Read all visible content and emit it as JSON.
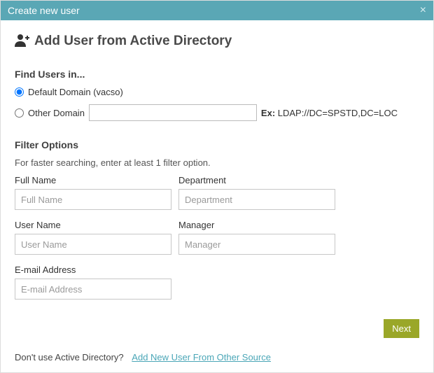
{
  "titlebar": {
    "title": "Create new user",
    "close_glyph": "×"
  },
  "header": {
    "title": "Add User from Active Directory"
  },
  "find_users": {
    "section_label": "Find Users in...",
    "default_domain": {
      "label": "Default Domain (vacso)",
      "checked": true
    },
    "other_domain": {
      "label": "Other Domain",
      "checked": false,
      "input_value": "",
      "hint_prefix": "Ex:",
      "hint_value": " LDAP://DC=SPSTD,DC=LOC"
    }
  },
  "filter": {
    "section_label": "Filter Options",
    "sub": "For faster searching, enter at least 1 filter option.",
    "fields": {
      "full_name": {
        "label": "Full Name",
        "placeholder": "Full Name",
        "value": ""
      },
      "department": {
        "label": "Department",
        "placeholder": "Department",
        "value": ""
      },
      "user_name": {
        "label": "User Name",
        "placeholder": "User Name",
        "value": ""
      },
      "manager": {
        "label": "Manager",
        "placeholder": "Manager",
        "value": ""
      },
      "email": {
        "label": "E-mail Address",
        "placeholder": "E-mail Address",
        "value": ""
      }
    }
  },
  "actions": {
    "next_label": "Next"
  },
  "footer": {
    "question": "Don't use Active Directory?",
    "link_text": "Add New User From Other Source"
  }
}
